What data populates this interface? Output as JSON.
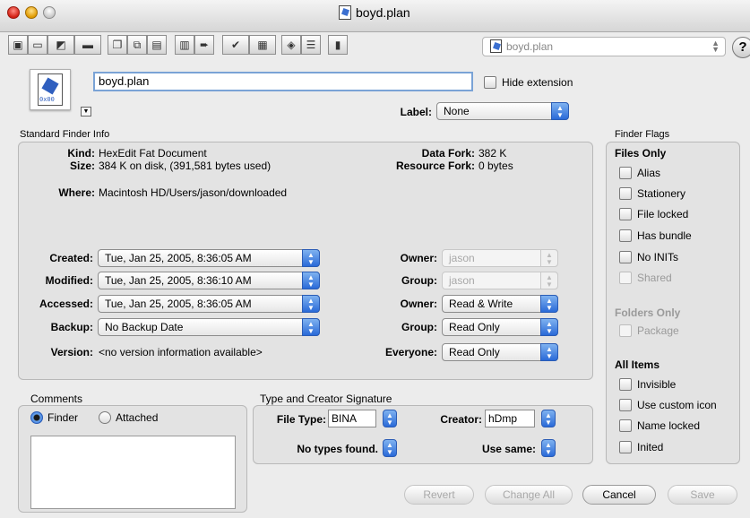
{
  "window": {
    "title": "boyd.plan"
  },
  "toolbar": {
    "file_popup_value": "boyd.plan",
    "help_label": "?"
  },
  "file": {
    "name": "boyd.plan",
    "hide_extension_label": "Hide extension",
    "label_caption": "Label:",
    "label_value": "None",
    "icon_code": "0x00"
  },
  "standard_info": {
    "title": "Standard Finder Info",
    "kind_label": "Kind:",
    "kind_value": "HexEdit Fat Document",
    "size_label": "Size:",
    "size_value": "384 K on disk, (391,581 bytes used)",
    "data_fork_label": "Data Fork:",
    "data_fork_value": "382 K",
    "resource_fork_label": "Resource Fork:",
    "resource_fork_value": "0 bytes",
    "where_label": "Where:",
    "where_value": "Macintosh HD/Users/jason/downloaded",
    "created_label": "Created:",
    "created_value": "Tue, Jan 25, 2005, 8:36:05 AM",
    "modified_label": "Modified:",
    "modified_value": "Tue, Jan 25, 2005, 8:36:10 AM",
    "accessed_label": "Accessed:",
    "accessed_value": "Tue, Jan 25, 2005, 8:36:05 AM",
    "backup_label": "Backup:",
    "backup_value": "No Backup Date",
    "version_label": "Version:",
    "version_value": "<no version information available>",
    "owner_label": "Owner:",
    "owner_value": "jason",
    "group_label": "Group:",
    "group_value": "jason",
    "owner_perm_label": "Owner:",
    "owner_perm_value": "Read & Write",
    "group_perm_label": "Group:",
    "group_perm_value": "Read Only",
    "everyone_label": "Everyone:",
    "everyone_value": "Read Only"
  },
  "flags": {
    "title": "Finder Flags",
    "files_only": "Files Only",
    "alias": "Alias",
    "stationery": "Stationery",
    "file_locked": "File locked",
    "has_bundle": "Has bundle",
    "no_inits": "No INITs",
    "shared": "Shared",
    "folders_only": "Folders Only",
    "package": "Package",
    "all_items": "All Items",
    "invisible": "Invisible",
    "use_custom_icon": "Use custom icon",
    "name_locked": "Name locked",
    "inited": "Inited"
  },
  "comments": {
    "title": "Comments",
    "finder_label": "Finder",
    "attached_label": "Attached"
  },
  "signature": {
    "title": "Type and Creator Signature",
    "file_type_label": "File Type:",
    "file_type_value": "BINA",
    "creator_label": "Creator:",
    "creator_value": "hDmp",
    "no_types_label": "No types found.",
    "use_same_label": "Use same:"
  },
  "buttons": {
    "revert": "Revert",
    "change_all": "Change All",
    "cancel": "Cancel",
    "save": "Save"
  }
}
